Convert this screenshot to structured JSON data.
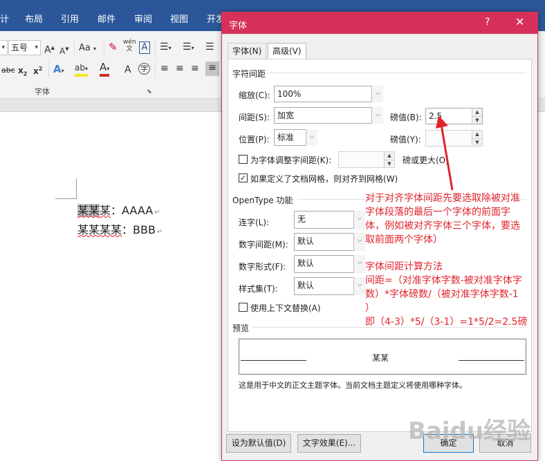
{
  "ribbon": {
    "tabs": [
      "计",
      "布局",
      "引用",
      "邮件",
      "审阅",
      "视图",
      "开发"
    ],
    "font_size": "五号",
    "case_label": "Aa",
    "group_label": "字体",
    "pinyin_icon_text": "wén 文",
    "boxed_char": "A",
    "circled_char": "字"
  },
  "document": {
    "line1": {
      "highlighted": "某某",
      "rest": "某",
      "suffix": "：AAAA"
    },
    "line2": {
      "prefix": "某某某某",
      "suffix": "：BBB"
    },
    "para_mark": "↵"
  },
  "dialog": {
    "title": "字体",
    "help": "?",
    "close": "✕",
    "tabs": {
      "font": "字体(N)",
      "advanced": "高级(V)"
    },
    "spacing_section": "字符间距",
    "scale": {
      "label": "缩放(C):",
      "value": "100%"
    },
    "spacing": {
      "label": "间距(S):",
      "value": "加宽",
      "pts_label": "磅值(B):",
      "pts_value": "2.5"
    },
    "position": {
      "label": "位置(P):",
      "value": "标准",
      "pts_label": "磅值(Y):",
      "pts_value": ""
    },
    "kerning": {
      "label": "为字体调整字间距(K):",
      "value": "",
      "suffix": "磅或更大(O)",
      "checked": false
    },
    "snap_grid": {
      "label": "如果定义了文档网格，则对齐到网格(W)",
      "checked": true
    },
    "opentype_section": "OpenType 功能",
    "ligatures": {
      "label": "连字(L):",
      "value": "无"
    },
    "number_spacing": {
      "label": "数字间距(M):",
      "value": "默认"
    },
    "number_forms": {
      "label": "数字形式(F):",
      "value": "默认"
    },
    "stylistic_sets": {
      "label": "样式集(T):",
      "value": "默认"
    },
    "contextual": {
      "label": "使用上下文替换(A)",
      "checked": false
    },
    "preview_section": "预览",
    "preview_text": "某某",
    "preview_note": "这是用于中文的正文主题字体。当前文档主题定义将使用哪种字体。",
    "buttons": {
      "set_default": "设为默认值(D)",
      "text_effects": "文字效果(E)...",
      "ok": "确定",
      "cancel": "取消"
    }
  },
  "annotations": {
    "note1": [
      "对于对齐字体间距先要选取除被对准",
      "字体段落的最后一个字体的前面字",
      "体，例如被对齐字体三个字体，要选",
      "取前面两个字体）"
    ],
    "note2": [
      "字体间距计算方法",
      "间距=（对准字体字数-被对准字体字",
      "数）*字体磅数/（被对准字体字数-1",
      "）",
      "即（4-3）*5/（3-1）=1*5/2=2.5磅"
    ],
    "arrow_color": "#e0242d"
  },
  "watermark": "Baidu经验"
}
